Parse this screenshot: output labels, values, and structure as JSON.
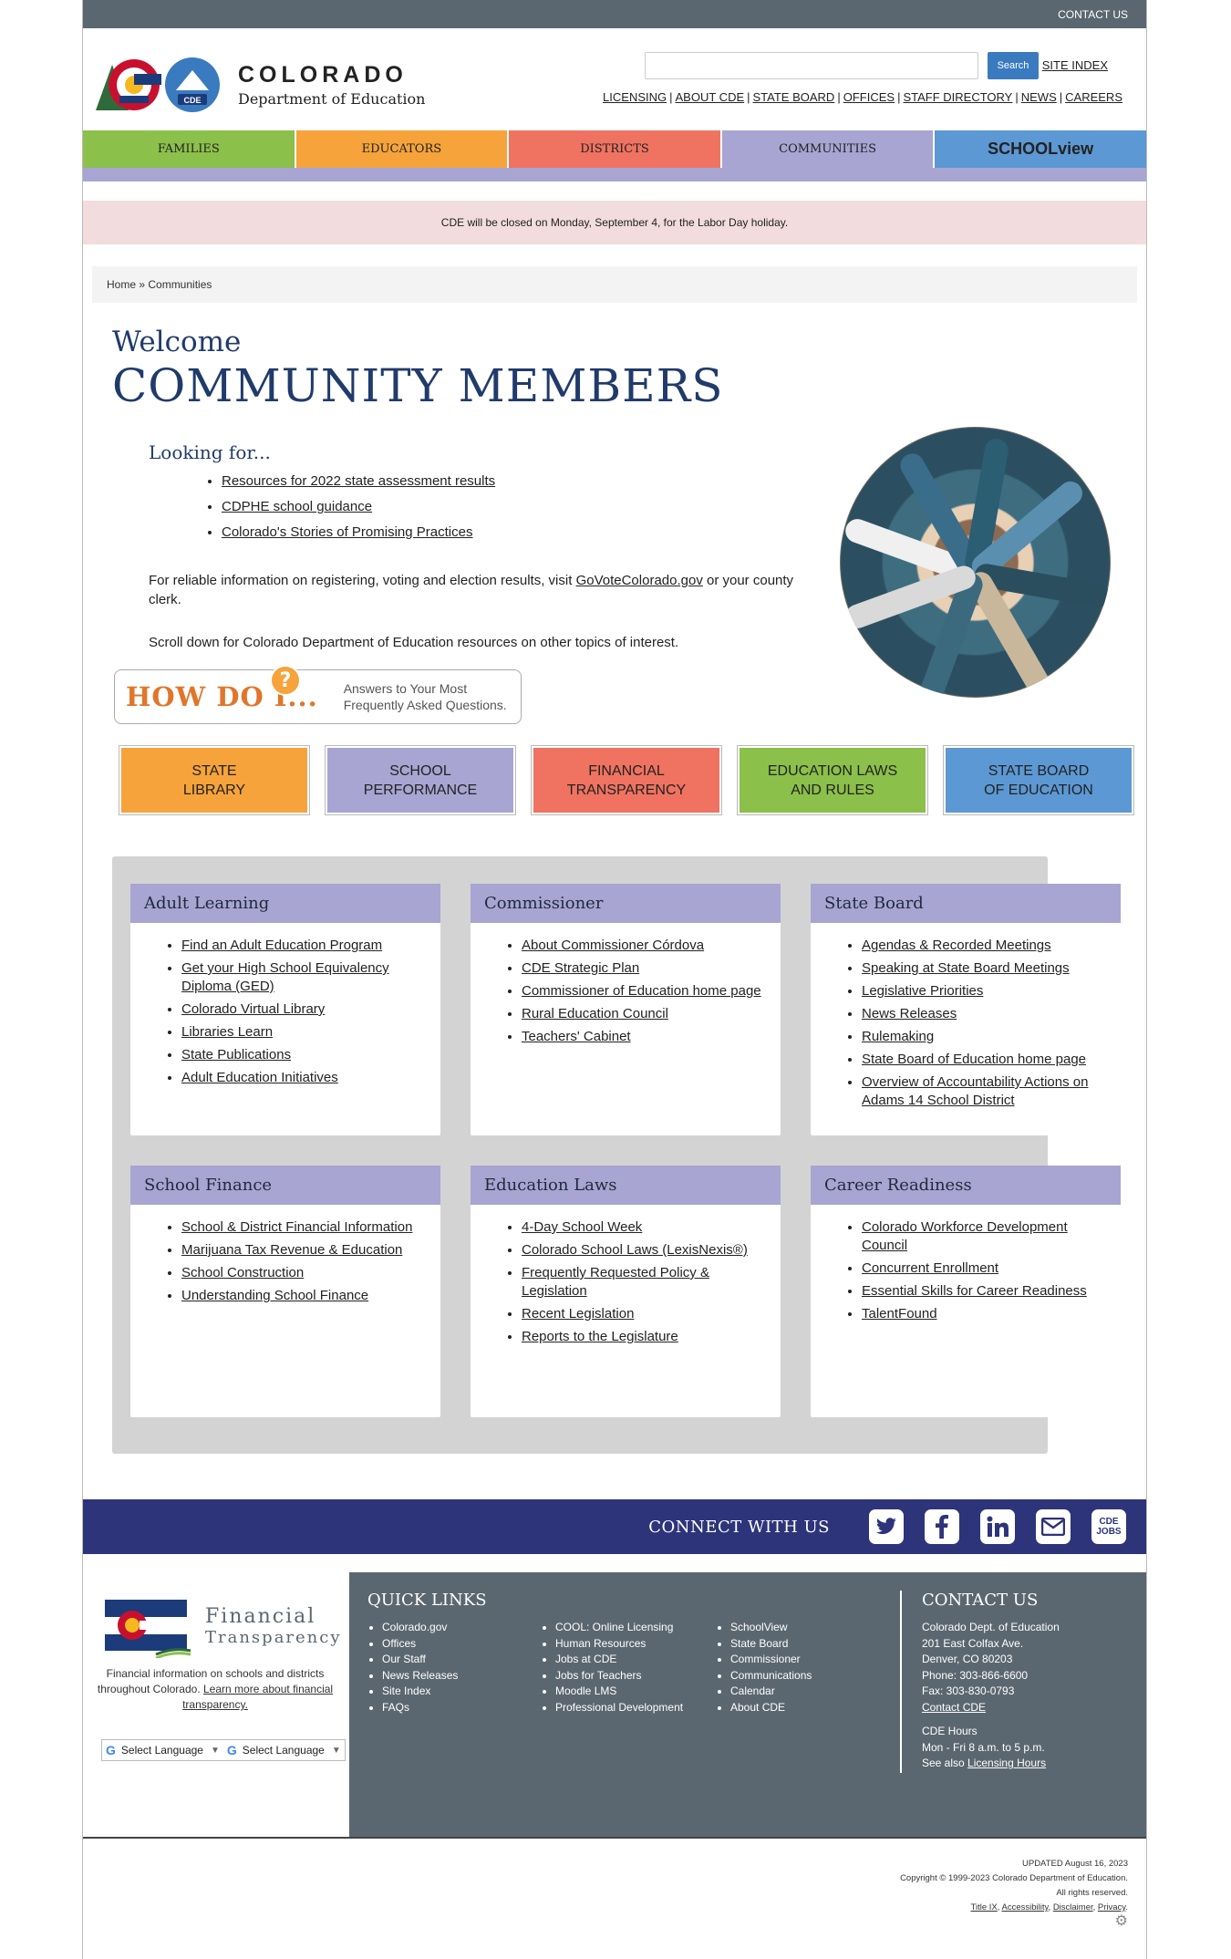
{
  "topbar": {
    "contact": "CONTACT US"
  },
  "header": {
    "logo_line1": "COLORADO",
    "logo_line2": "Department of Education",
    "logo_badge": "CDE",
    "search_placeholder": "",
    "search_button": "Search",
    "site_index": "SITE INDEX",
    "util_links": [
      "LICENSING",
      "ABOUT CDE",
      "STATE BOARD",
      "OFFICES",
      "STAFF DIRECTORY",
      "NEWS",
      "CAREERS"
    ]
  },
  "nav": {
    "families": "FAMILIES",
    "educators": "EDUCATORS",
    "districts": "DISTRICTS",
    "communities": "COMMUNITIES",
    "schoolview": "SCHOOLview"
  },
  "notice": "CDE will be closed on Monday, September 4, for the Labor Day holiday.",
  "breadcrumb": "Home » Communities",
  "intro": {
    "welcome": "Welcome",
    "headline": "COMMUNITY MEMBERS",
    "looking_for": "Looking for...",
    "links": [
      "Resources for 2022 state assessment results",
      "CDPHE school guidance",
      "Colorado's Stories of Promising Practices"
    ],
    "para1_before": "For reliable information on registering, voting and election results, visit ",
    "para1_link": "GoVoteColorado.gov",
    "para1_after": " or your county clerk.",
    "para2": "Scroll down for Colorado Department of Education resources on other topics of interest."
  },
  "howdo": {
    "title": "HOW DO I...",
    "q": "?",
    "sub1": "Answers to Your Most",
    "sub2": "Frequently Asked Questions."
  },
  "quick_buttons": [
    {
      "l1": "STATE",
      "l2": "LIBRARY"
    },
    {
      "l1": "SCHOOL",
      "l2": "PERFORMANCE"
    },
    {
      "l1": "FINANCIAL",
      "l2": "TRANSPARENCY"
    },
    {
      "l1": "EDUCATION LAWS",
      "l2": "AND RULES"
    },
    {
      "l1": "STATE BOARD",
      "l2": "OF EDUCATION"
    }
  ],
  "cards": [
    {
      "title": "Adult Learning",
      "links": [
        "Find an Adult Education Program",
        "Get your High School Equivalency Diploma (GED)",
        "Colorado Virtual Library",
        "Libraries Learn",
        "State Publications",
        "Adult Education Initiatives"
      ]
    },
    {
      "title": "Commissioner",
      "links": [
        "About Commissioner Córdova",
        "CDE Strategic Plan",
        "Commissioner of Education home page",
        "Rural Education Council",
        "Teachers' Cabinet"
      ]
    },
    {
      "title": "State Board",
      "links": [
        "Agendas & Recorded Meetings",
        "Speaking at State Board Meetings",
        "Legislative Priorities",
        "News Releases",
        "Rulemaking",
        "State Board of Education home page",
        "Overview of Accountability Actions on Adams 14 School District"
      ]
    },
    {
      "title": "School Finance",
      "links": [
        "School & District Financial Information",
        "Marijuana Tax Revenue & Education",
        "School Construction",
        "Understanding School Finance"
      ]
    },
    {
      "title": "Education Laws",
      "links": [
        "4-Day School Week",
        "Colorado School Laws (LexisNexis®)",
        "Frequently Requested Policy & Legislation",
        "Recent Legislation",
        "Reports to the Legislature"
      ]
    },
    {
      "title": "Career Readiness",
      "links": [
        "Colorado Workforce Development Council",
        "Concurrent Enrollment",
        "Essential Skills for Career Readiness",
        "TalentFound"
      ]
    }
  ],
  "connect": {
    "label": "CONNECT WITH US",
    "jobs1": "CDE",
    "jobs2": "JOBS"
  },
  "footer": {
    "ft_title1": "Financial",
    "ft_title2": "Transparency",
    "ft_desc": "Financial information on schools and districts throughout Colorado. ",
    "ft_link": "Learn more about financial transparency.",
    "lang": "Select Language",
    "quick_links_title": "QUICK LINKS",
    "ql1": [
      "Colorado.gov",
      "Offices",
      "Our Staff",
      "News Releases",
      "Site Index",
      "FAQs"
    ],
    "ql2": [
      "COOL: Online Licensing",
      "Human Resources",
      "Jobs at CDE",
      "Jobs for Teachers",
      "Moodle LMS",
      "Professional Development"
    ],
    "ql3": [
      "SchoolView",
      "State Board",
      "Commissioner",
      "Communications",
      "Calendar",
      "About CDE"
    ],
    "contact_title": "CONTACT US",
    "contact": [
      "Colorado Dept. of Education",
      "201 East Colfax Ave.",
      "Denver, CO 80203",
      "Phone: 303-866-6600",
      "Fax: 303-830-0793"
    ],
    "contact_link": "Contact CDE",
    "hours_title": "CDE Hours",
    "hours": "Mon - Fri 8 a.m. to 5 p.m.",
    "see_also": "See also ",
    "hours_link": "Licensing Hours"
  },
  "legal": {
    "updated": "UPDATED August 16, 2023",
    "copyright": "Copyright © 1999-2023 Colorado Department of Education.",
    "rights": "All rights reserved.",
    "links": [
      "Title IX",
      "Accessibility",
      "Disclaimer",
      "Privacy"
    ]
  },
  "colors": {
    "navy": "#203b6b",
    "footer_gray": "#5b6770",
    "connect_blue": "#2d3479",
    "lavender": "#a8a5d2"
  },
  "icons": [
    "twitter-icon",
    "facebook-icon",
    "linkedin-icon",
    "email-icon",
    "cde-jobs-icon",
    "gear-icon"
  ]
}
